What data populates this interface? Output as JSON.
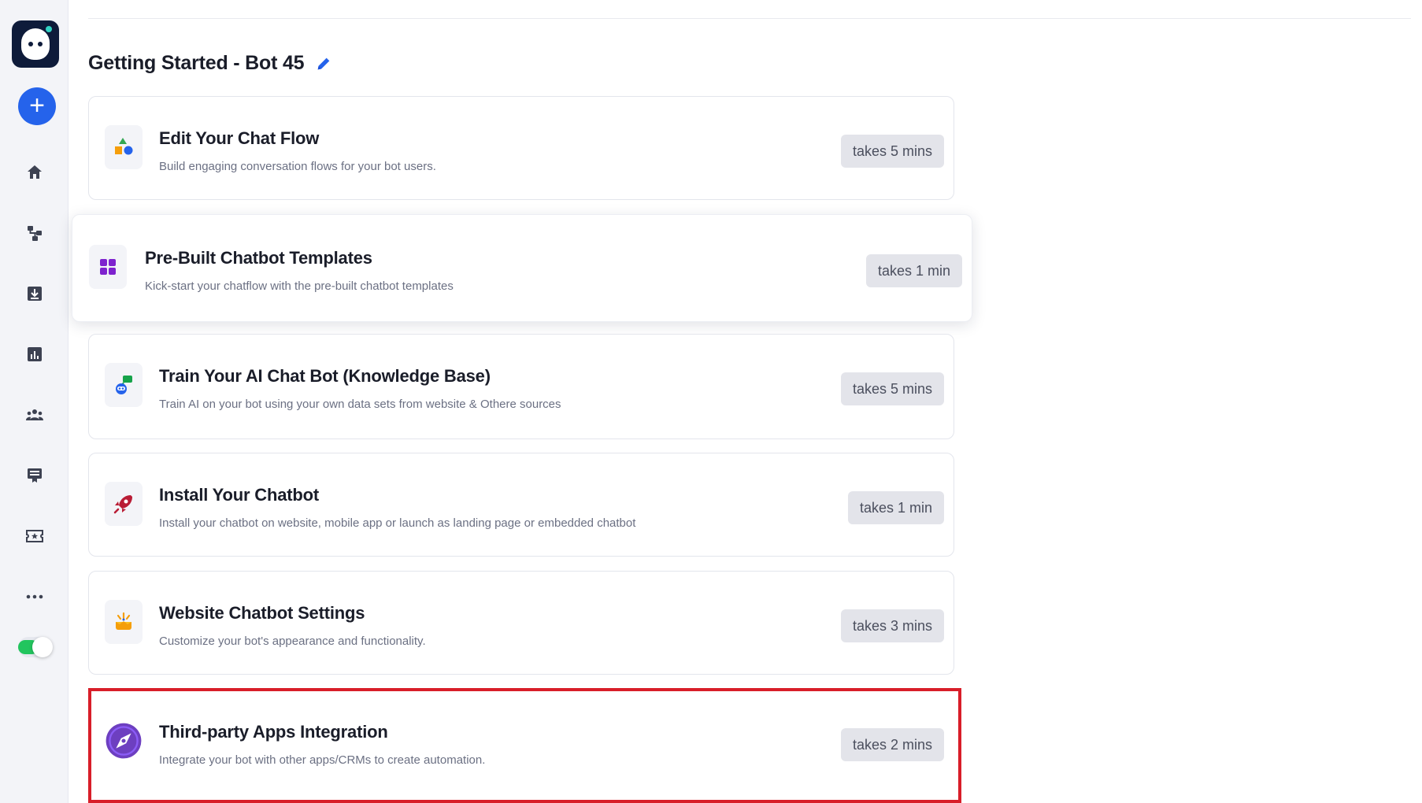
{
  "sidebar": {
    "items": [
      {
        "name": "home",
        "icon": "home-icon"
      },
      {
        "name": "flows",
        "icon": "flow-icon"
      },
      {
        "name": "inbox",
        "icon": "download-icon"
      },
      {
        "name": "analytics",
        "icon": "chart-icon"
      },
      {
        "name": "team",
        "icon": "users-icon"
      },
      {
        "name": "channels",
        "icon": "kiosk-icon"
      },
      {
        "name": "tickets",
        "icon": "ticket-star-icon"
      },
      {
        "name": "more",
        "icon": "more-icon"
      }
    ]
  },
  "header": {
    "title": "Getting Started - Bot 45"
  },
  "steps": [
    {
      "title": "Edit Your Chat Flow",
      "description": "Build engaging conversation flows for your bot users.",
      "time": "takes 5 mins",
      "icon": "shapes-icon"
    },
    {
      "title": "Pre-Built Chatbot Templates",
      "description": "Kick-start your chatflow with the pre-built chatbot templates",
      "time": "takes 1 min",
      "icon": "grid-icon"
    },
    {
      "title": "Train Your AI Chat Bot (Knowledge Base)",
      "description": "Train AI on your bot using your own data sets from website & Othere sources",
      "time": "takes 5 mins",
      "icon": "ai-robot-icon"
    },
    {
      "title": "Install Your Chatbot",
      "description": "Install your chatbot on website, mobile app or launch as landing page or embedded chatbot",
      "time": "takes 1 min",
      "icon": "rocket-icon"
    },
    {
      "title": "Website Chatbot Settings",
      "description": "Customize your bot's appearance and functionality.",
      "time": "takes 3 mins",
      "icon": "settings-sparkle-icon"
    },
    {
      "title": "Third-party Apps Integration",
      "description": "Integrate your bot with other apps/CRMs to create automation.",
      "time": "takes 2 mins",
      "icon": "compass-icon"
    }
  ],
  "colors": {
    "accent": "#2563eb",
    "highlight": "#d81e29",
    "toggle_on": "#22c55e"
  }
}
